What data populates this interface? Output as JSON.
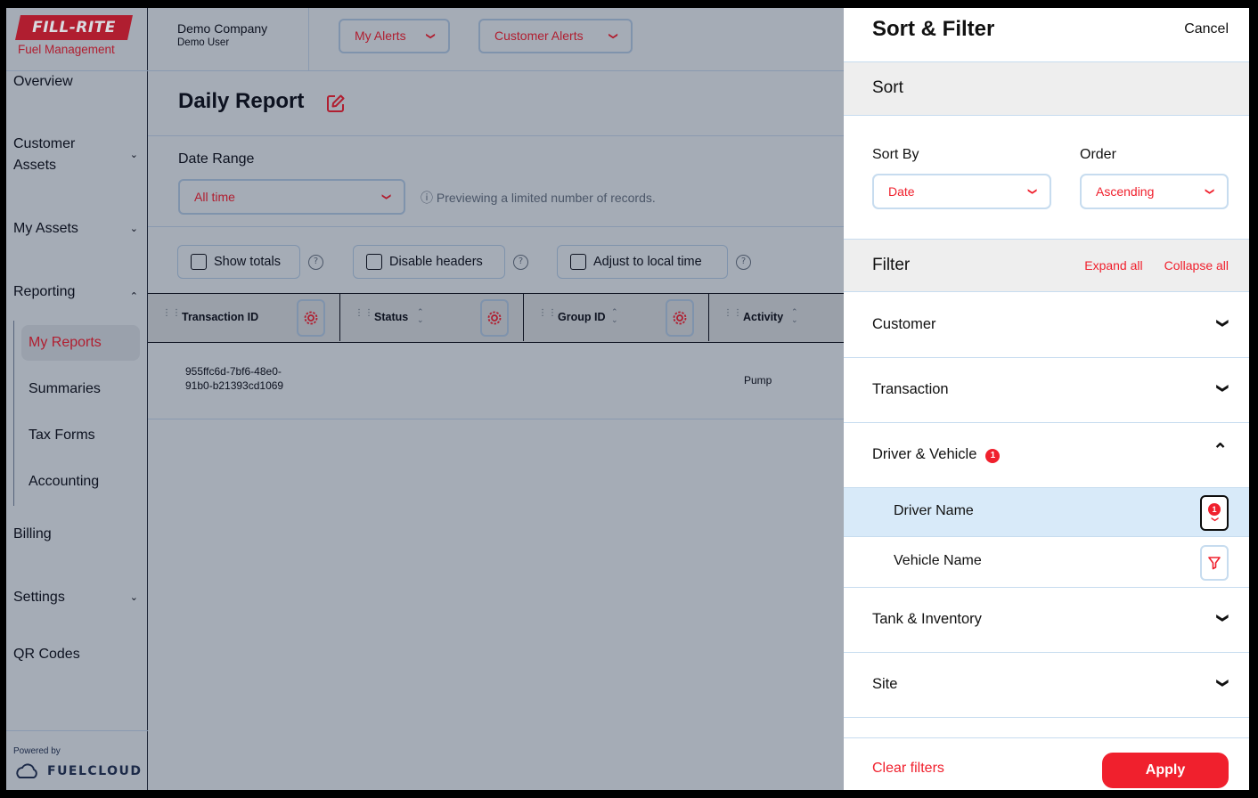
{
  "brand": {
    "logo_text": "FILL-RITE",
    "logo_sub": "Fuel Management",
    "powered_by": "Powered by",
    "fuelcloud": "FUELCLOUD"
  },
  "header": {
    "company": "Demo Company",
    "user": "Demo User",
    "alerts": [
      {
        "label": "My Alerts"
      },
      {
        "label": "Customer Alerts"
      }
    ]
  },
  "sidebar": {
    "items": [
      {
        "label": "Overview"
      },
      {
        "label": "Customer Assets",
        "chevron": "down"
      },
      {
        "label": "My Assets",
        "chevron": "down"
      },
      {
        "label": "Reporting",
        "chevron": "up"
      },
      {
        "label": "Billing"
      },
      {
        "label": "Settings",
        "chevron": "down"
      },
      {
        "label": "QR Codes"
      }
    ],
    "reporting_sub": [
      {
        "label": "My Reports",
        "active": true
      },
      {
        "label": "Summaries"
      },
      {
        "label": "Tax Forms"
      },
      {
        "label": "Accounting"
      }
    ]
  },
  "page": {
    "title": "Daily Report",
    "date_range_label": "Date Range",
    "date_range_value": "All time",
    "preview_note": "Previewing a limited number of records.",
    "options": [
      {
        "label": "Show totals",
        "checked": false
      },
      {
        "label": "Disable headers",
        "checked": false
      },
      {
        "label": "Adjust to local time",
        "checked": false
      }
    ]
  },
  "table": {
    "columns": [
      "Transaction ID",
      "Status",
      "Group ID",
      "Activity"
    ],
    "rows": [
      {
        "transaction_id_line1": "955ffc6d-7bf6-48e0-",
        "transaction_id_line2": "91b0-b21393cd1069",
        "status": "",
        "group_id": "",
        "activity": "Pump"
      }
    ]
  },
  "panel": {
    "title": "Sort & Filter",
    "cancel": "Cancel",
    "sort": {
      "heading": "Sort",
      "sort_by_label": "Sort By",
      "sort_by_value": "Date",
      "order_label": "Order",
      "order_value": "Ascending"
    },
    "filter": {
      "heading": "Filter",
      "expand_all": "Expand all",
      "collapse_all": "Collapse all",
      "groups": [
        {
          "label": "Customer",
          "expanded": false
        },
        {
          "label": "Transaction",
          "expanded": false
        },
        {
          "label": "Driver & Vehicle",
          "expanded": true,
          "badge": "1",
          "fields": [
            {
              "label": "Driver Name",
              "active": true,
              "badge": "1"
            },
            {
              "label": "Vehicle Name",
              "active": false
            }
          ]
        },
        {
          "label": "Tank & Inventory",
          "expanded": false
        },
        {
          "label": "Site",
          "expanded": false
        }
      ]
    },
    "clear_filters": "Clear filters",
    "apply": "Apply"
  },
  "colors": {
    "accent": "#f0202d",
    "brand_red": "#b01e30",
    "active_row": "#d8eaf9",
    "overlay_bg": "#a5acb6"
  }
}
